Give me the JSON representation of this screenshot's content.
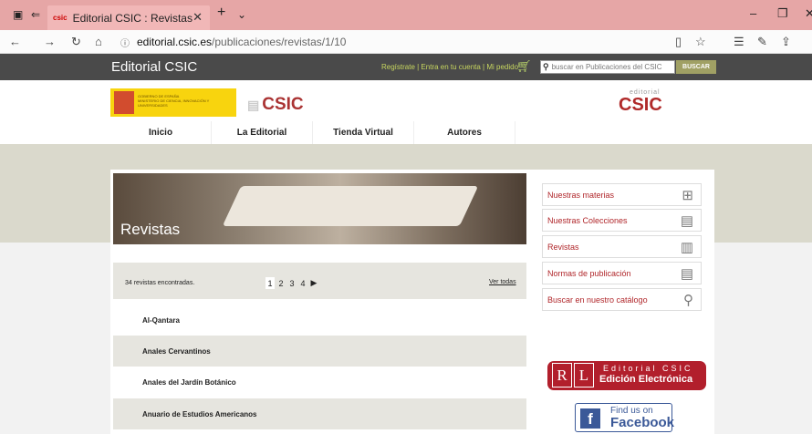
{
  "browser": {
    "tab_title": "Editorial CSIC : Revistas",
    "tab_favicon": "csic",
    "url_host": "editorial.csic.es",
    "url_path": "/publicaciones/revistas/1/10"
  },
  "site": {
    "brand": "Editorial CSIC",
    "account_links": "Regístrate | Entra en tu cuenta | Mi pedido",
    "search_placeholder": "buscar en Publicaciones del CSIC",
    "search_button": "BUSCAR",
    "csic_logo": "CSIC",
    "editorial_logo_small": "editorial",
    "editorial_logo_big": "CSIC",
    "gov_logo_lines": [
      "GOBIERNO DE ESPAÑA",
      "MINISTERIO DE CIENCIA, INNOVACIÓN Y UNIVERSIDADES"
    ]
  },
  "menu": [
    "Inicio",
    "La Editorial",
    "Tienda Virtual",
    "Autores"
  ],
  "banner_title": "Revistas",
  "list": {
    "count_text": "34 revistas encontradas.",
    "pages": [
      "1",
      "2",
      "3",
      "4"
    ],
    "current_page": "1",
    "see_all": "Ver todas",
    "items": [
      "Al-Qantara",
      "Anales Cervantinos",
      "Anales del Jardín Botánico",
      "Anuario de Estudios Americanos"
    ]
  },
  "sidebar": [
    {
      "label": "Nuestras materias",
      "icon": "plus-doc-icon"
    },
    {
      "label": "Nuestras Colecciones",
      "icon": "documents-icon"
    },
    {
      "label": "Revistas",
      "icon": "open-book-icon"
    },
    {
      "label": "Normas de publicación",
      "icon": "document-icon"
    },
    {
      "label": "Buscar en nuestro catálogo",
      "icon": "magnifier-icon"
    }
  ],
  "ed_electronica": {
    "rl": [
      "R",
      "L"
    ],
    "line1": "Editorial CSIC",
    "line2": "Edición Electrónica"
  },
  "facebook": {
    "line1": "Find us on",
    "line2": "Facebook"
  },
  "colors": {
    "accent": "#b0262a",
    "header_dark": "#4a4a4a",
    "band": "#dad9cc"
  }
}
